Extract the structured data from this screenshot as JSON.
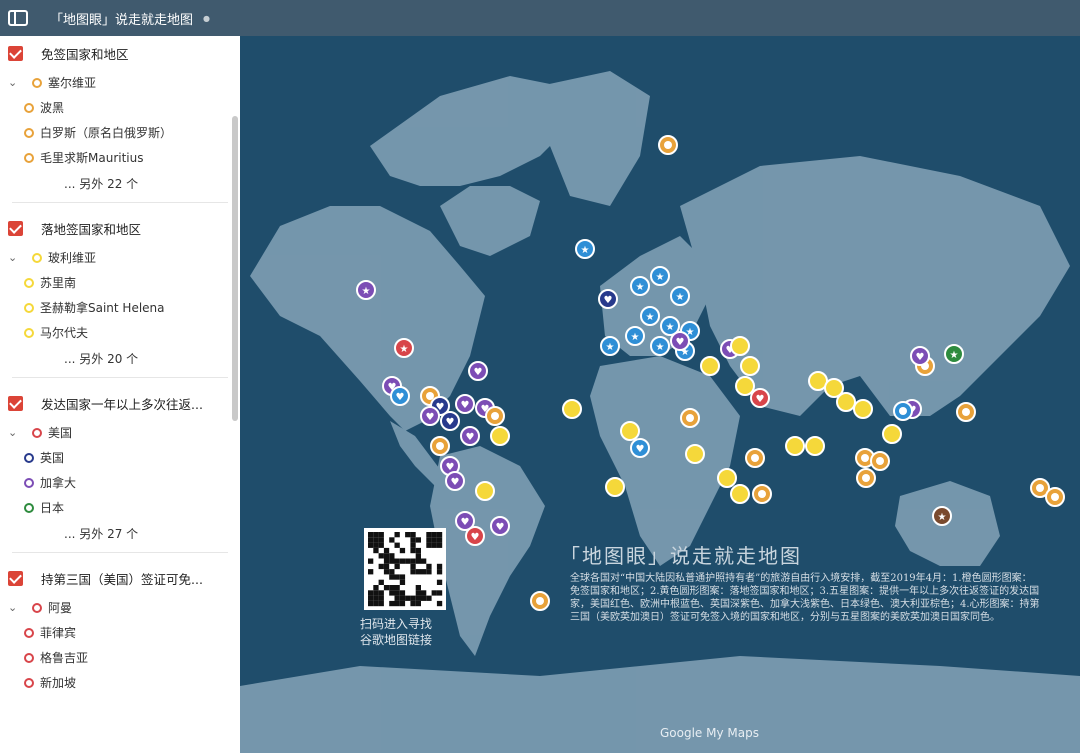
{
  "header": {
    "title": "「地图眼」说走就走地图"
  },
  "sidebar": {
    "layers": [
      {
        "title": "免签国家和地区",
        "color": "#e8a23a",
        "items": [
          "塞尔维亚",
          "波黑",
          "白罗斯（原名白俄罗斯）",
          "毛里求斯Mauritius"
        ],
        "more": "... 另外 22 个"
      },
      {
        "title": "落地签国家和地区",
        "color": "#f5d83a",
        "items": [
          "玻利维亚",
          "苏里南",
          "圣赫勒拿Saint Helena",
          "马尔代夫"
        ],
        "more": "... 另外 20 个"
      },
      {
        "title": "发达国家一年以上多次往返...",
        "colors": [
          "#d8454a",
          "#283a8c",
          "#7c4db5",
          "#2e8b3e"
        ],
        "items": [
          "美国",
          "英国",
          "加拿大",
          "日本"
        ],
        "more": "... 另外 27 个"
      },
      {
        "title": "持第三国（美国）签证可免...",
        "color": "#d8454a",
        "items": [
          "阿曼",
          "菲律宾",
          "格鲁吉亚",
          "新加坡"
        ],
        "more": ""
      }
    ]
  },
  "map": {
    "overlay_title": "「地图眼」说走就走地图",
    "description": "全球各国对“中国大陆因私普通护照持有者”的旅游自由行入境安排，截至2019年4月：1.橙色圆形图案：免签国家和地区；2.黄色圆形图案：落地签国家和地区；3.五星图案：提供一年以上多次往返签证的发达国家，美国红色、欧洲中根蓝色、英国深紫色、加拿大浅紫色、日本绿色、澳大利亚棕色；4.心形图案：持第三国（美欧英加澳日）签证可免签入境的国家和地区，分别与五星图案的美欧英加澳日国家同色。",
    "qr_label": [
      "扫码进入寻找",
      "谷歌地图链接"
    ],
    "attribution": "Google My Maps",
    "colors": {
      "ocean": "#1f4d6b",
      "land": "#7e9fb4",
      "free": "#e8a23a",
      "arrival": "#f5d83a",
      "usa": "#d8454a",
      "europe": "#2f8fd6",
      "uk": "#283a8c",
      "canada": "#7c4db5",
      "japan": "#2e8b3e",
      "australia": "#7a4a2e"
    }
  }
}
